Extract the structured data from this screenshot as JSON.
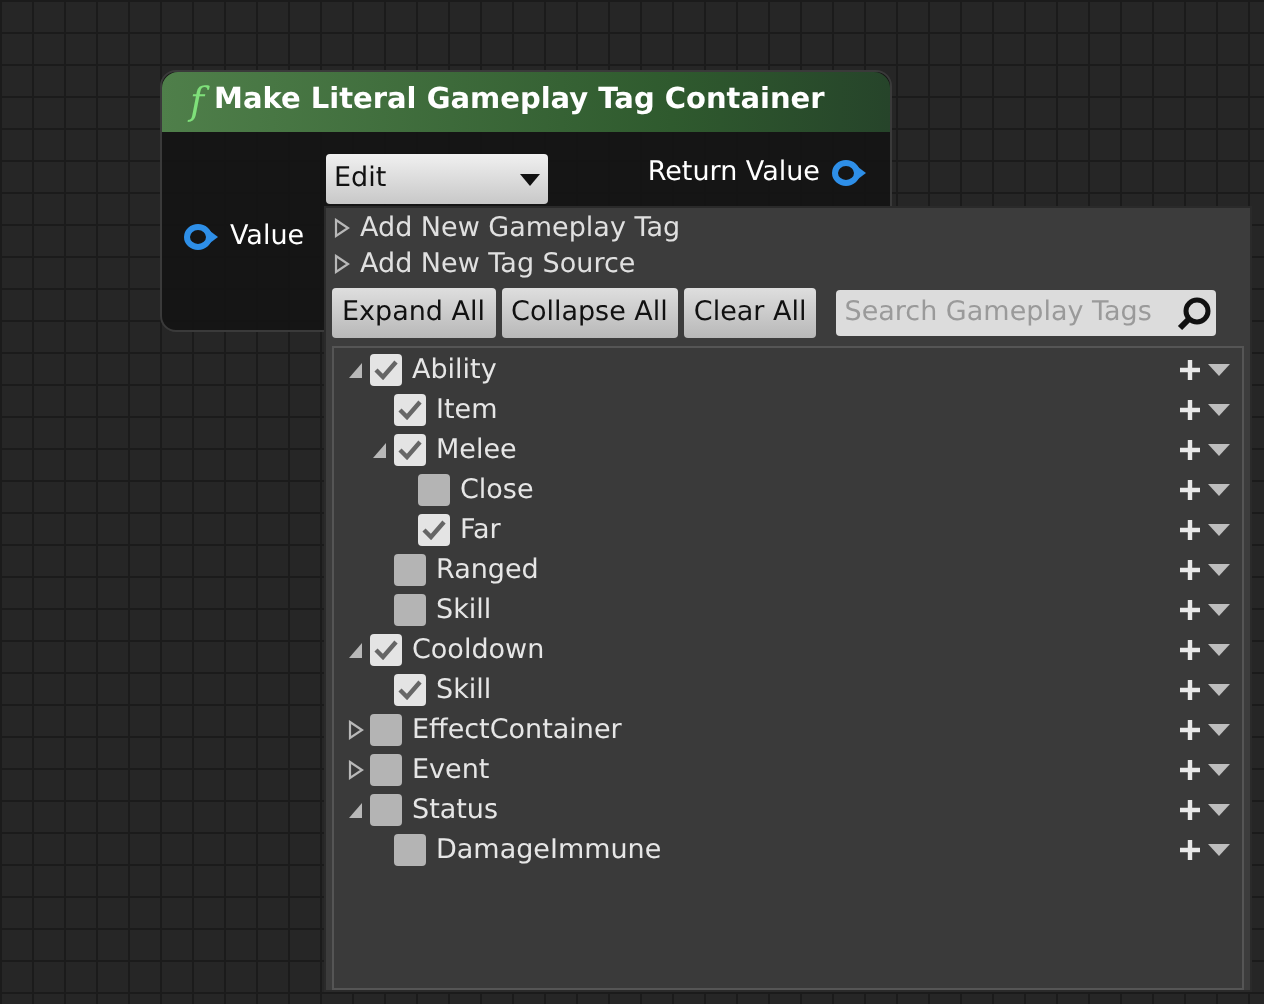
{
  "node": {
    "icon_glyph": "f",
    "title": "Make Literal Gameplay Tag Container",
    "dropdown": {
      "value": "Edit"
    },
    "input_pin": {
      "label": "Value"
    },
    "output_pin": {
      "label": "Return Value"
    }
  },
  "tag_editor": {
    "sections": [
      {
        "label": "Add New Gameplay Tag",
        "expanded": false
      },
      {
        "label": "Add New Tag Source",
        "expanded": false
      }
    ],
    "buttons": [
      "Expand All",
      "Collapse All",
      "Clear All"
    ],
    "search": {
      "placeholder": "Search Gameplay Tags"
    },
    "tags": [
      {
        "label": "Ability",
        "checked": true,
        "expanded": true,
        "children": [
          {
            "label": "Item",
            "checked": true
          },
          {
            "label": "Melee",
            "checked": true,
            "expanded": true,
            "children": [
              {
                "label": "Close",
                "checked": false
              },
              {
                "label": "Far",
                "checked": true
              }
            ]
          },
          {
            "label": "Ranged",
            "checked": false
          },
          {
            "label": "Skill",
            "checked": false
          }
        ]
      },
      {
        "label": "Cooldown",
        "checked": true,
        "expanded": true,
        "children": [
          {
            "label": "Skill",
            "checked": true
          }
        ]
      },
      {
        "label": "EffectContainer",
        "checked": false,
        "expanded": false
      },
      {
        "label": "Event",
        "checked": false,
        "expanded": false
      },
      {
        "label": "Status",
        "checked": false,
        "expanded": true,
        "children": [
          {
            "label": "DamageImmune",
            "checked": false
          }
        ]
      }
    ]
  }
}
